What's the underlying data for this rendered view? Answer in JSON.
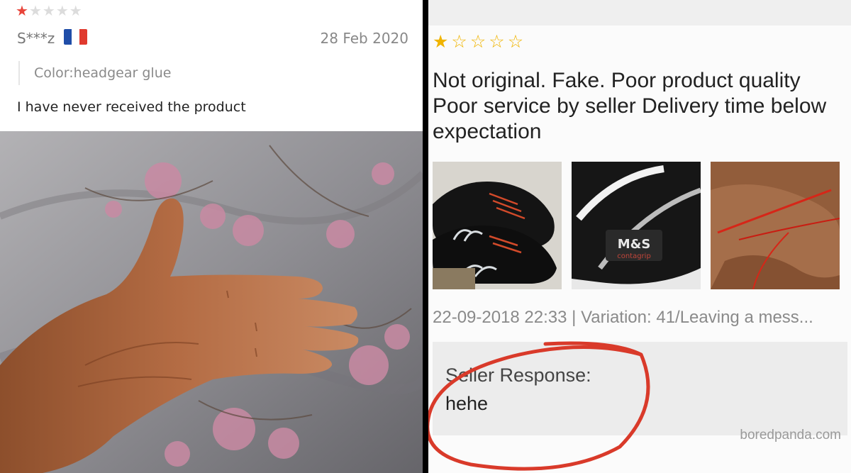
{
  "left_review": {
    "rating": 1,
    "max_rating": 5,
    "reviewer": "S***z",
    "country_flag_colors": [
      "#1f4da8",
      "#ffffff",
      "#e03a2e"
    ],
    "date": "28 Feb 2020",
    "variant": "Color:headgear glue",
    "text": "I have never received the product"
  },
  "right_review": {
    "rating": 1,
    "max_rating": 5,
    "headline": "Not original. Fake. Poor product quality Poor service by seller  Delivery time below expectation",
    "thumbnails": [
      {
        "icon": "black-sneakers-photo"
      },
      {
        "icon": "shoe-logo-photo",
        "brand_text": "M&S",
        "brand_sub": "contagrip"
      },
      {
        "icon": "red-string-photo"
      }
    ],
    "meta": "22-09-2018 22:33 | Variation: 41/Leaving a mess...",
    "seller_response_label": "Seller Response:",
    "seller_response": "hehe",
    "watermark": "boredpanda.com"
  },
  "colors": {
    "left_star_active": "#e8443a",
    "right_star": "#f0b400",
    "annotation_circle": "#d93a2a"
  }
}
